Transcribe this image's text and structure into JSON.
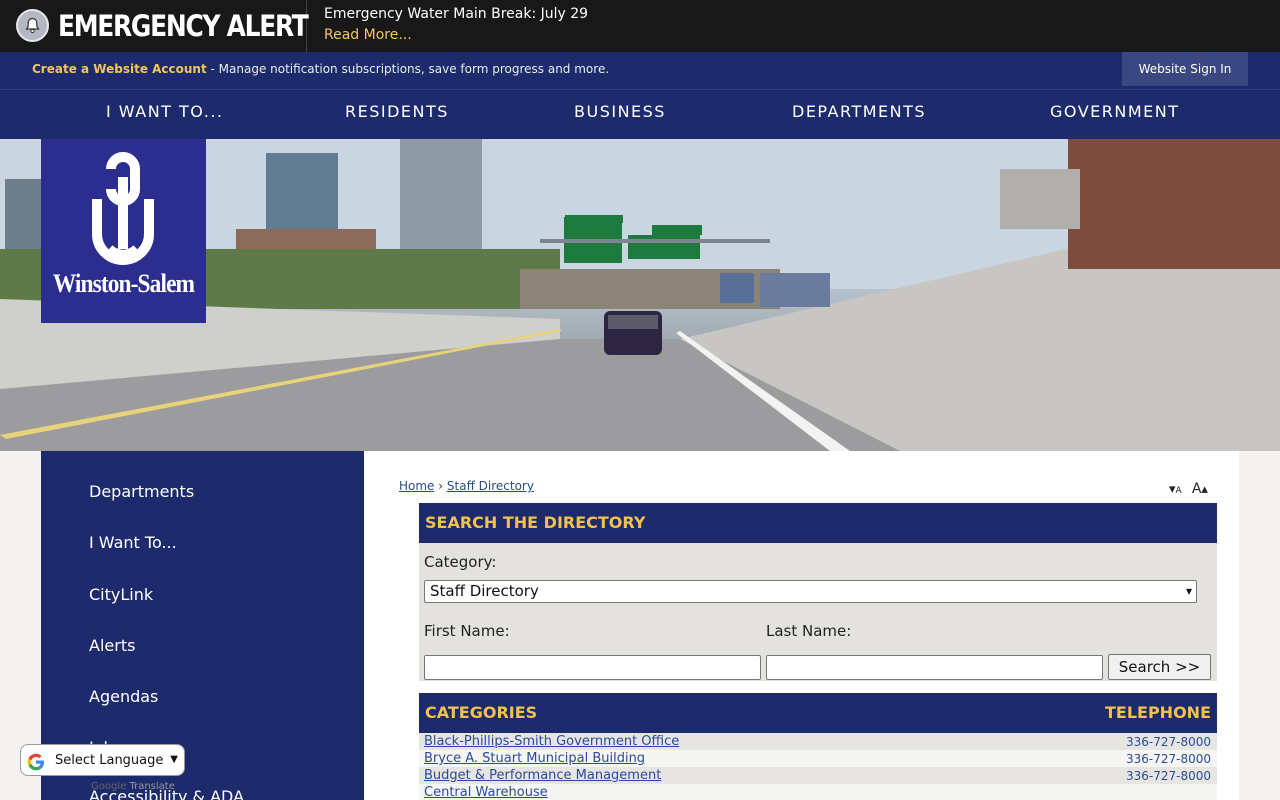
{
  "alert": {
    "title": "EMERGENCY ALERT",
    "message": "Emergency Water Main Break: July 29",
    "read_more": "Read More..."
  },
  "account_bar": {
    "create_link": "Create a Website Account",
    "description": " - Manage notification subscriptions, save form progress and more.",
    "sign_in": "Website Sign In"
  },
  "nav": {
    "items": [
      "I WANT TO...",
      "RESIDENTS",
      "BUSINESS",
      "DEPARTMENTS",
      "GOVERNMENT"
    ]
  },
  "logo": {
    "text": "Winston-Salem"
  },
  "sidebar": {
    "items": [
      "Departments",
      "I Want To...",
      "CityLink",
      "Alerts",
      "Agendas",
      "Jobs",
      "Accessibility & ADA"
    ]
  },
  "breadcrumb": {
    "home": "Home",
    "separator": "›",
    "current": "Staff Directory"
  },
  "text_resize": {
    "decrease": "A",
    "increase": "A"
  },
  "search": {
    "heading": "SEARCH THE DIRECTORY",
    "category_label": "Category:",
    "category_value": "Staff Directory",
    "first_name_label": "First Name:",
    "last_name_label": "Last Name:",
    "first_name_value": "",
    "last_name_value": "",
    "button": "Search >>"
  },
  "categories": {
    "heading": "CATEGORIES",
    "phone_heading": "TELEPHONE",
    "rows": [
      {
        "name": "Black-Phillips-Smith Government Office",
        "phone": "336-727-8000"
      },
      {
        "name": "Bryce A. Stuart Municipal Building",
        "phone": "336-727-8000"
      },
      {
        "name": "Budget & Performance Management",
        "phone": "336-727-8000"
      },
      {
        "name": "Central Warehouse",
        "phone": ""
      }
    ]
  },
  "translate": {
    "label": "Select Language",
    "powered_prefix": "Google",
    "powered_suffix": "Translate"
  },
  "colors": {
    "navy": "#1d2a6b",
    "gold": "#f2c14e",
    "alert_bg": "#181818",
    "logo_bg": "#2b2e8f"
  }
}
